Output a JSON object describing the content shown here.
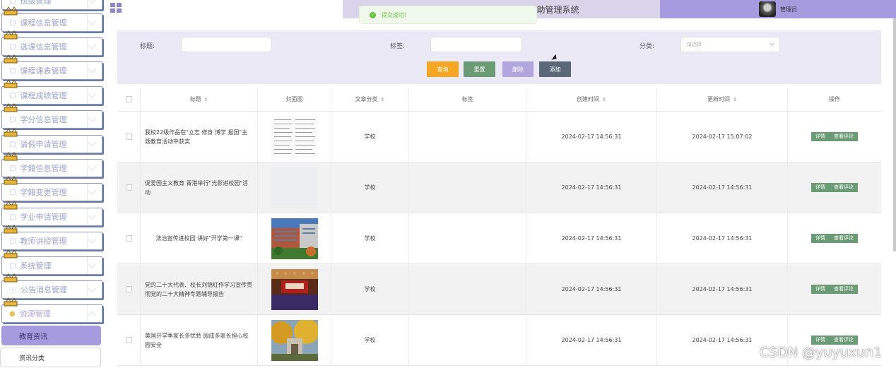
{
  "sidebar": {
    "items": [
      {
        "label": "班级管理",
        "icon": "folder-icon"
      },
      {
        "label": "课程信息管理",
        "icon": "folder-icon"
      },
      {
        "label": "选课信息管理",
        "icon": "folder-icon"
      },
      {
        "label": "课程课表管理",
        "icon": "folder-icon"
      },
      {
        "label": "课程成绩管理",
        "icon": "folder-icon"
      },
      {
        "label": "学分信息管理",
        "icon": "folder-icon"
      },
      {
        "label": "请假申请管理",
        "icon": "folder-icon"
      },
      {
        "label": "学籍信息管理",
        "icon": "folder-icon"
      },
      {
        "label": "学籍变更管理",
        "icon": "folder-icon"
      },
      {
        "label": "学业申请管理",
        "icon": "folder-icon"
      },
      {
        "label": "教师讲授管理",
        "icon": "folder-icon"
      },
      {
        "label": "系统管理",
        "icon": "folder-icon"
      },
      {
        "label": "公告消息管理",
        "icon": "info-icon"
      },
      {
        "label": "资源管理",
        "icon": "dot-icon"
      }
    ],
    "sub_active": "教育资讯",
    "sub_item": "资讯分类"
  },
  "header": {
    "title": "助管理系统",
    "user": "管理员"
  },
  "toast": {
    "message": "提交成功!"
  },
  "search": {
    "title_label": "标题:",
    "tag_label": "标签:",
    "category_label": "分类:",
    "category_placeholder": "请选择",
    "buttons": {
      "query": "查询",
      "reset": "重置",
      "delete": "删除",
      "add": "添加"
    }
  },
  "table": {
    "headers": [
      "标题",
      "封面图",
      "文章分类",
      "标签",
      "创建时间",
      "更新时间",
      "操作"
    ],
    "rows": [
      {
        "title": "我校22级作品在\"立志 修身 博学 报国\"主题教育活动中获奖",
        "category": "学校",
        "tag": "",
        "created": "2024-02-17 14:56:31",
        "updated": "2024-02-17 15:07:02"
      },
      {
        "title": "促爱国主义教育 青港举行\"光影进校园\"活动",
        "category": "学校",
        "tag": "",
        "created": "2024-02-17 14:56:31",
        "updated": "2024-02-17 14:56:31"
      },
      {
        "title": "法治宣传进校园 讲好\"开学第一课\"",
        "category": "学校",
        "tag": "",
        "created": "2024-02-17 14:56:31",
        "updated": "2024-02-17 14:56:31"
      },
      {
        "title": "党的二十大代表、校长刘锦红作学习宣传贯彻党的二十大精神专题辅导报告",
        "category": "学校",
        "tag": "",
        "created": "2024-02-17 14:56:31",
        "updated": "2024-02-17 14:56:31"
      },
      {
        "title": "美国开学季家长多忧愁 园成多家长担心校园安全",
        "category": "学校",
        "tag": "",
        "created": "2024-02-17 14:56:31",
        "updated": "2024-02-17 14:56:31"
      }
    ],
    "op_detail": "详情",
    "op_comment": "查看评论"
  },
  "watermark": "CSDN @yuyuxun1",
  "colors": {
    "accent": "#a79be0",
    "query_button": "#f5a623",
    "reset_button": "#6b9b75",
    "delete_button": "#b3a6df",
    "add_button": "#5a6878",
    "success": "#67c23a"
  }
}
